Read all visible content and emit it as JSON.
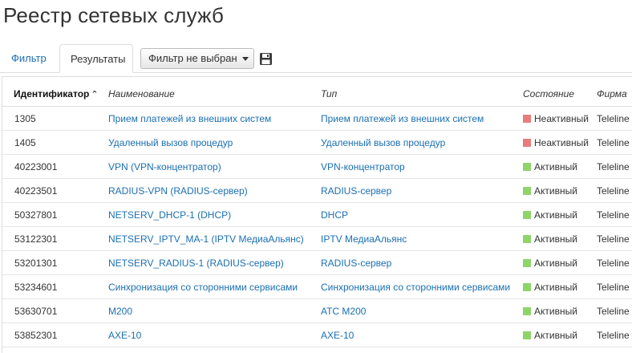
{
  "page": {
    "title": "Реестр сетевых служб"
  },
  "tabs": {
    "filter": "Фильтр",
    "results": "Результаты"
  },
  "toolbar": {
    "filter_select": "Фильтр не выбран",
    "save_icon": "save-icon"
  },
  "colors": {
    "link": "#1a6fb0",
    "inactive": "#e87c7c",
    "active": "#8fd46a"
  },
  "table": {
    "columns": {
      "id": "Идентификатор",
      "name": "Наименование",
      "type": "Тип",
      "state": "Состояние",
      "firm": "Фирма"
    },
    "sort_indicator": "^",
    "rows": [
      {
        "id": "1305",
        "name": "Прием платежей из внешних систем",
        "type": "Прием платежей из внешних систем",
        "state": "Неактивный",
        "status": "inactive",
        "firm": "Teleline"
      },
      {
        "id": "1405",
        "name": "Удаленный вызов процедур",
        "type": "Удаленный вызов процедур",
        "state": "Неактивный",
        "status": "inactive",
        "firm": "Teleline"
      },
      {
        "id": "40223001",
        "name": "VPN (VPN-концентратор)",
        "type": "VPN-концентратор",
        "state": "Активный",
        "status": "active",
        "firm": "Teleline"
      },
      {
        "id": "40223501",
        "name": "RADIUS-VPN (RADIUS-сервер)",
        "type": "RADIUS-сервер",
        "state": "Активный",
        "status": "active",
        "firm": "Teleline"
      },
      {
        "id": "50327801",
        "name": "NETSERV_DHCP-1 (DHCP)",
        "type": "DHCP",
        "state": "Активный",
        "status": "active",
        "firm": "Teleline"
      },
      {
        "id": "53122301",
        "name": "NETSERV_IPTV_MA-1 (IPTV МедиаАльянс)",
        "type": "IPTV МедиаАльянс",
        "state": "Активный",
        "status": "active",
        "firm": "Teleline"
      },
      {
        "id": "53201301",
        "name": "NETSERV_RADIUS-1 (RADIUS-сервер)",
        "type": "RADIUS-сервер",
        "state": "Активный",
        "status": "active",
        "firm": "Teleline"
      },
      {
        "id": "53234601",
        "name": "Синхронизация со сторонними сервисами",
        "type": "Синхронизация со сторонними сервисами",
        "state": "Активный",
        "status": "active",
        "firm": "Teleline"
      },
      {
        "id": "53630701",
        "name": "M200",
        "type": "АТС M200",
        "state": "Активный",
        "status": "active",
        "firm": "Teleline"
      },
      {
        "id": "53852301",
        "name": "AXE-10",
        "type": "AXE-10",
        "state": "Активный",
        "status": "active",
        "firm": "Teleline"
      }
    ]
  }
}
